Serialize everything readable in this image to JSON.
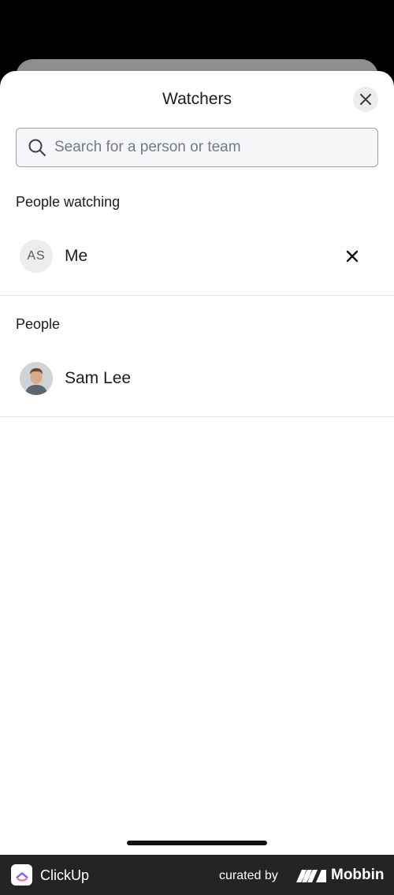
{
  "sheet": {
    "title": "Watchers",
    "close_icon": "close-icon"
  },
  "search": {
    "placeholder": "Search for a person or team",
    "value": "",
    "icon": "search-icon"
  },
  "watching": {
    "label": "People watching",
    "items": [
      {
        "initials": "AS",
        "name": "Me",
        "action_icon": "close-icon"
      }
    ]
  },
  "people": {
    "label": "People",
    "items": [
      {
        "avatar": "photo-avatar",
        "name": "Sam Lee"
      }
    ]
  },
  "footer": {
    "app_name": "ClickUp",
    "curated_by": "curated by",
    "brand": "Mobbin"
  },
  "colors": {
    "sheet_bg": "#ffffff",
    "search_bg": "#f4f6f8",
    "search_border": "#9aa3ad",
    "footer_bg": "#242424"
  }
}
